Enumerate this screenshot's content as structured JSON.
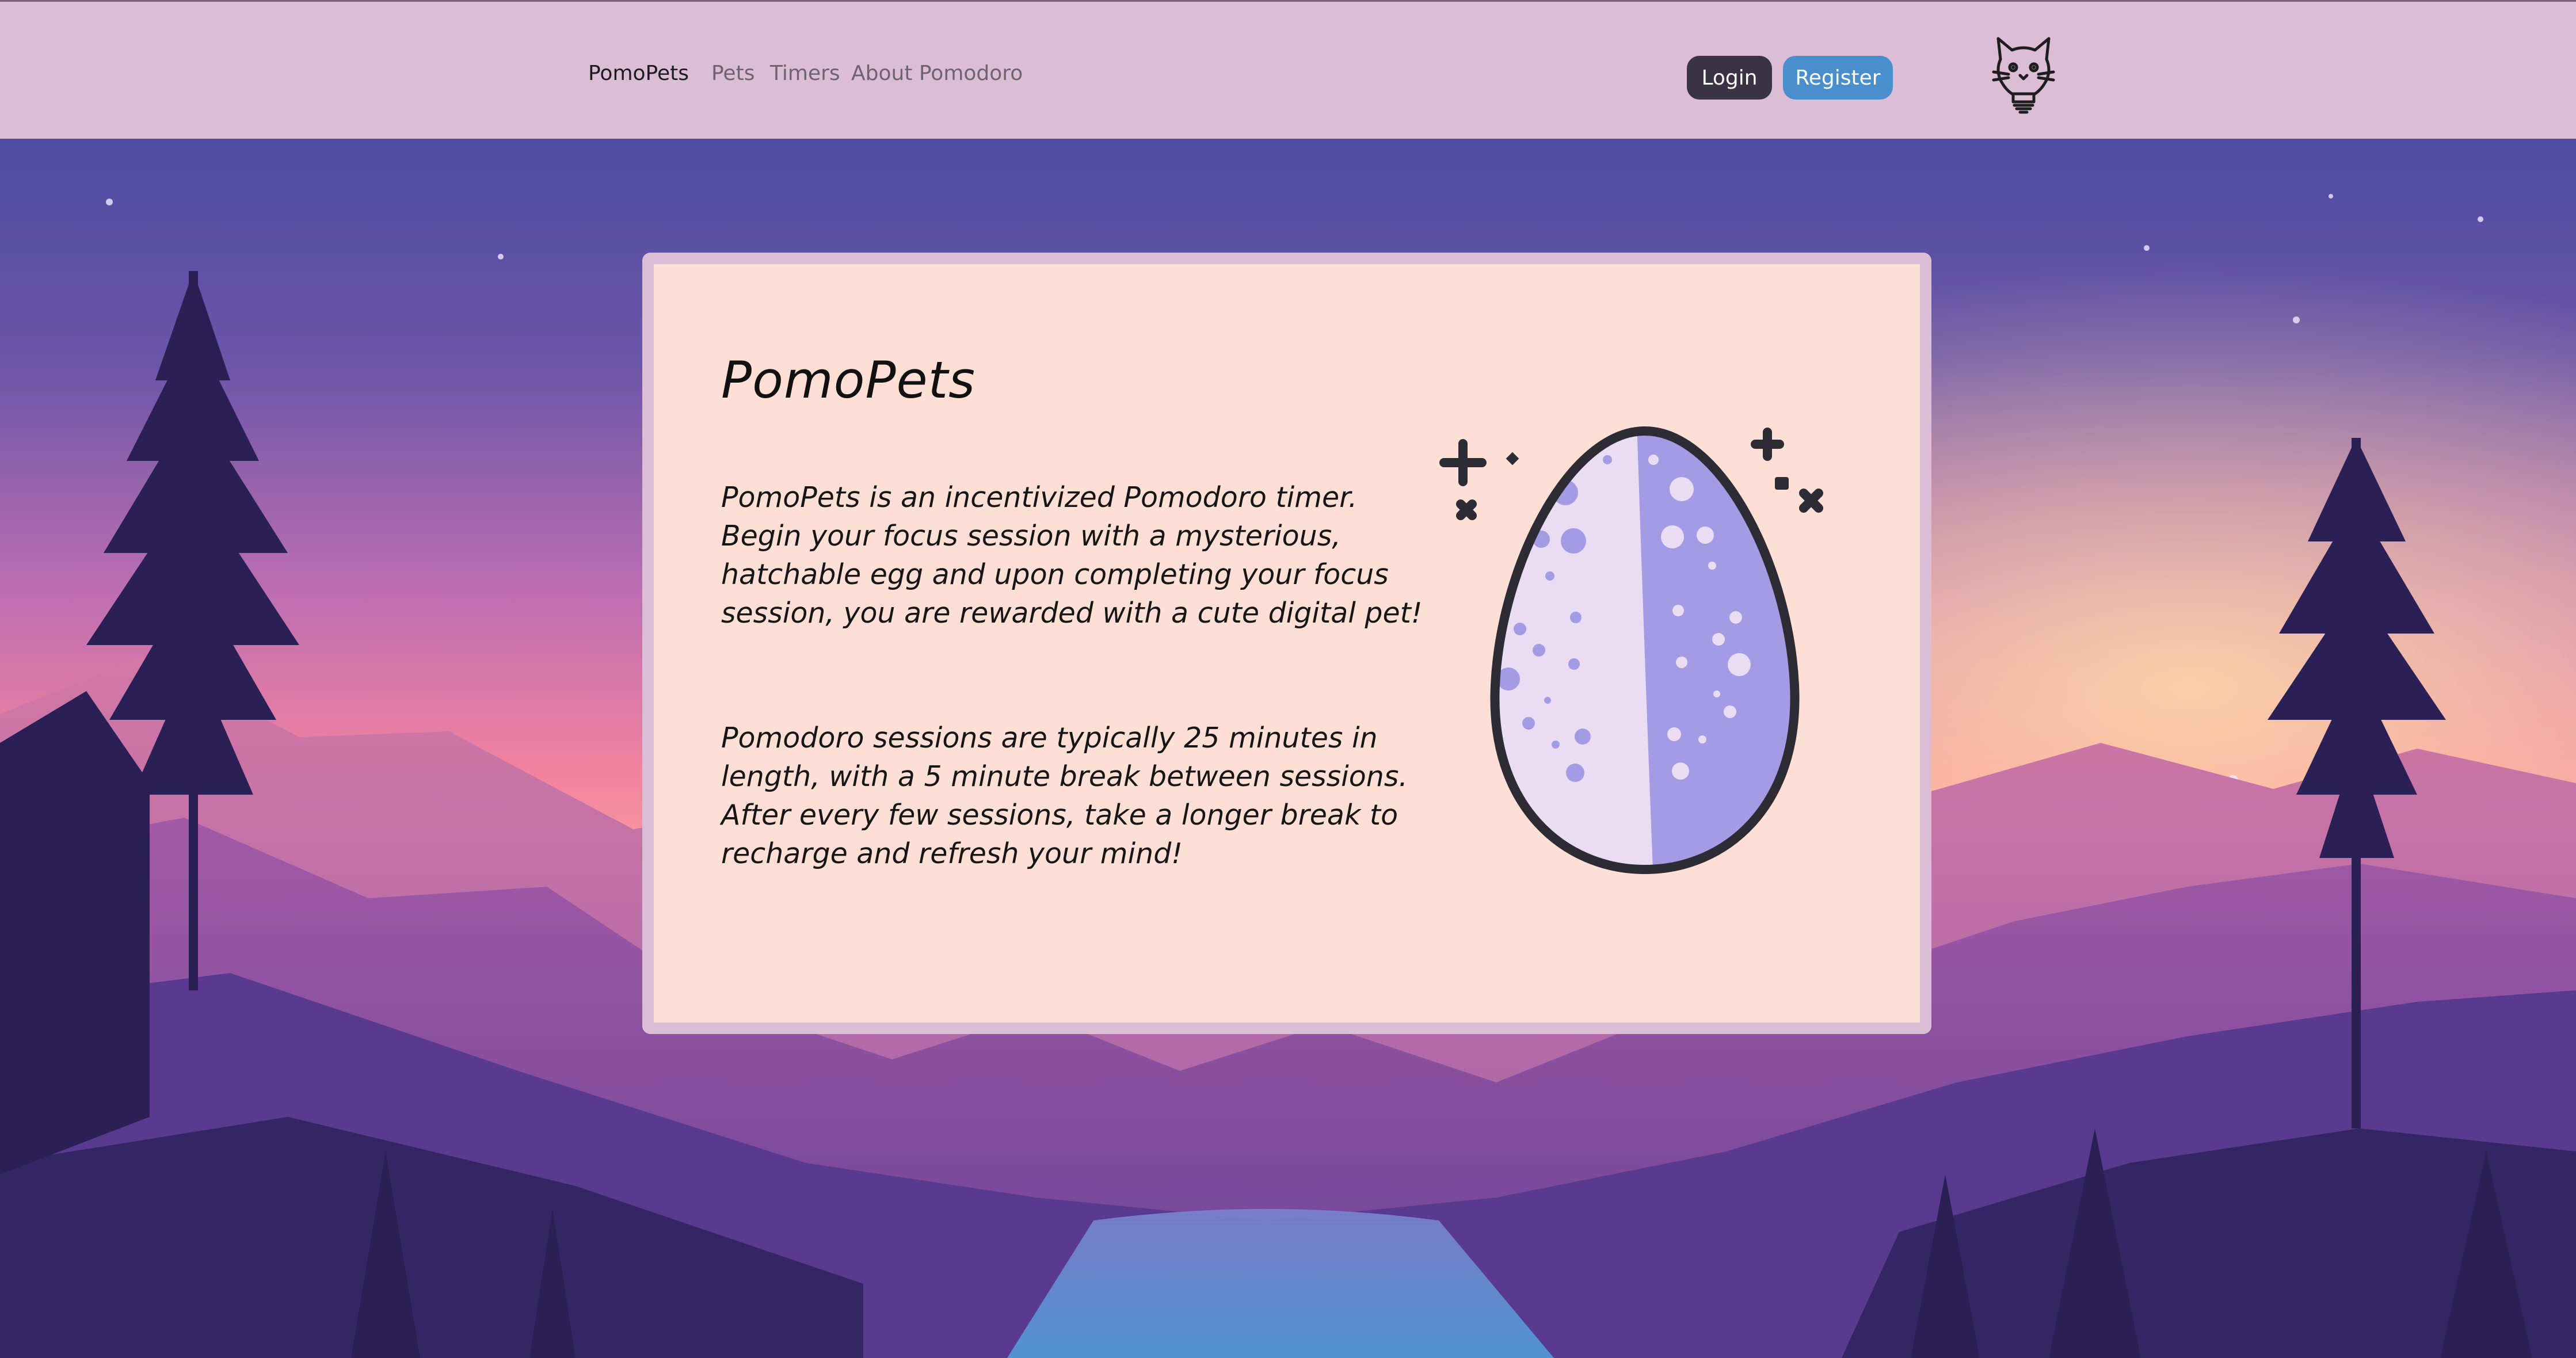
{
  "navbar": {
    "brand": "PomoPets",
    "links": [
      {
        "label": "Pets"
      },
      {
        "label": "Timers"
      },
      {
        "label": "About Pomodoro"
      }
    ],
    "login_label": "Login",
    "register_label": "Register",
    "logo_icon": "cat-lightbulb-icon"
  },
  "card": {
    "title": "PomoPets",
    "paragraphs": [
      "PomoPets is an incentivized Pomodoro timer. Begin your focus session with a mysterious, hatchable egg and upon completing your focus session, you are rewarded with a cute digital pet!",
      "Pomodoro sessions are typically 25 minutes in length, with a 5 minute break between sessions. After every few sessions, take a longer break to recharge and refresh your mind!"
    ],
    "illustration_icon": "spotted-egg-icon"
  },
  "colors": {
    "navbar_bg": "#dcbdd6",
    "card_border": "#dcbdd6",
    "card_bg": "#fedfd6",
    "login_bg": "#3a3245",
    "register_bg": "#4a8fcd",
    "egg_light": "#eadcf3",
    "egg_dark": "#a39be4"
  }
}
